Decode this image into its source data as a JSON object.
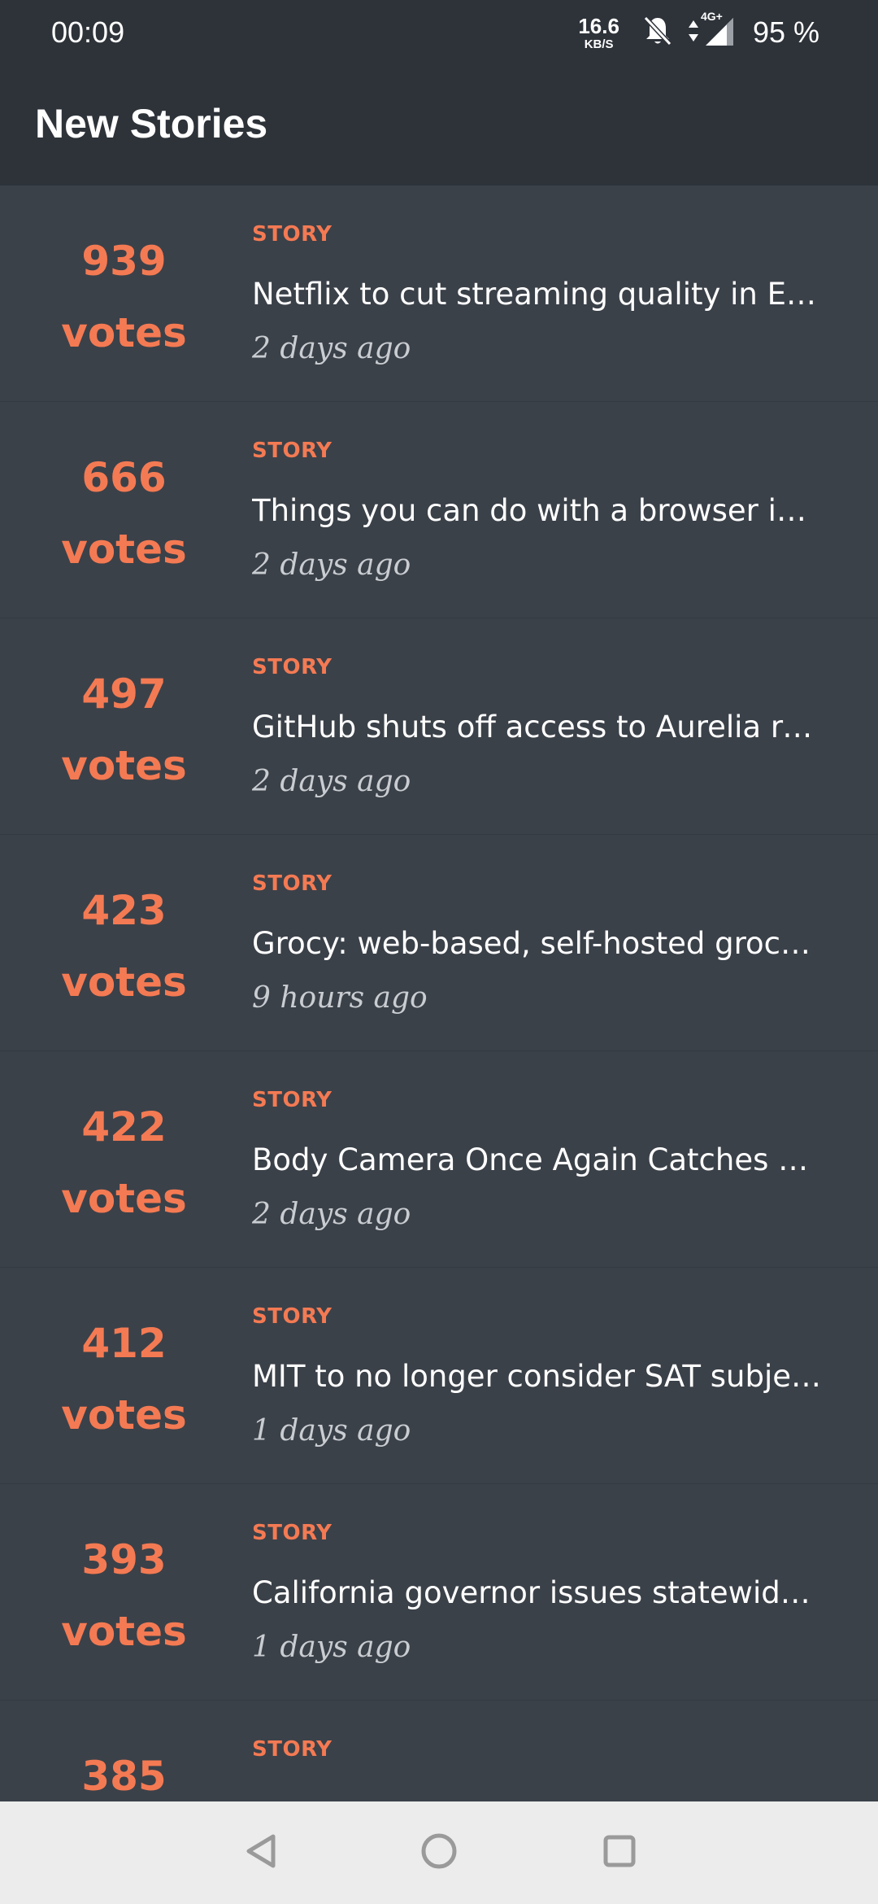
{
  "status_bar": {
    "time": "00:09",
    "net_speed_value": "16.6",
    "net_speed_unit": "KB/S",
    "network_type": "4G+",
    "battery": "95 %",
    "icons": [
      "bell-off-icon",
      "data-arrows-icon",
      "signal-icon"
    ]
  },
  "app_bar": {
    "title": "New Stories"
  },
  "colors": {
    "accent": "#f47a53",
    "background": "#3b4149",
    "header": "#2e333a",
    "nav_bar": "#ececec"
  },
  "stories": [
    {
      "votes": "939",
      "votes_label": "votes",
      "type": "STORY",
      "title": "Netflix to cut streaming quality in Eu...",
      "time": "2 days ago"
    },
    {
      "votes": "666",
      "votes_label": "votes",
      "type": "STORY",
      "title": "Things you can do with a browser in ...",
      "time": "2 days ago"
    },
    {
      "votes": "497",
      "votes_label": "votes",
      "type": "STORY",
      "title": "GitHub shuts off access to Aurelia re...",
      "time": "2 days ago"
    },
    {
      "votes": "423",
      "votes_label": "votes",
      "type": "STORY",
      "title": "Grocy: web-based, self-hosted grocer...",
      "time": "9 hours ago"
    },
    {
      "votes": "422",
      "votes_label": "votes",
      "type": "STORY",
      "title": "Body Camera Once Again Catches a...",
      "time": "2 days ago"
    },
    {
      "votes": "412",
      "votes_label": "votes",
      "type": "STORY",
      "title": "MIT to no longer consider SAT subjec...",
      "time": "1 days ago"
    },
    {
      "votes": "393",
      "votes_label": "votes",
      "type": "STORY",
      "title": "California governor issues statewide '...",
      "time": "1 days ago"
    },
    {
      "votes": "385",
      "votes_label": "",
      "type": "STORY",
      "title": "",
      "time": ""
    }
  ],
  "nav_bar": {
    "icons": [
      "back-icon",
      "home-icon",
      "recents-icon"
    ]
  }
}
